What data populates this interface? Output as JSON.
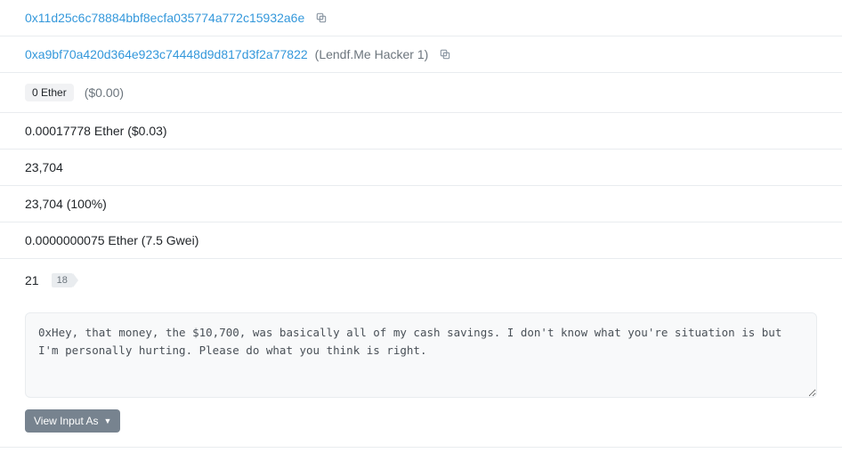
{
  "rows": {
    "fromAddress": "0x11d25c6c78884bbf8ecfa035774a772c15932a6e",
    "toAddress": "0xa9bf70a420d364e923c74448d9d817d3f2a77822",
    "toLabel": "(Lendf.Me Hacker 1)",
    "valueBadge": "0 Ether",
    "valueUsd": "($0.00)",
    "fee": "0.00017778 Ether ($0.03)",
    "gasLimit": "23,704",
    "gasUsed": "23,704 (100%)",
    "gasPrice": "0.0000000075 Ether (7.5 Gwei)",
    "nonce": "21",
    "position": "18"
  },
  "inputData": "0xHey, that money, the $10,700, was basically all of my cash savings. I don't know what you're situation is but I'm personally hurting. Please do what you think is right.",
  "viewInputLabel": "View Input As"
}
